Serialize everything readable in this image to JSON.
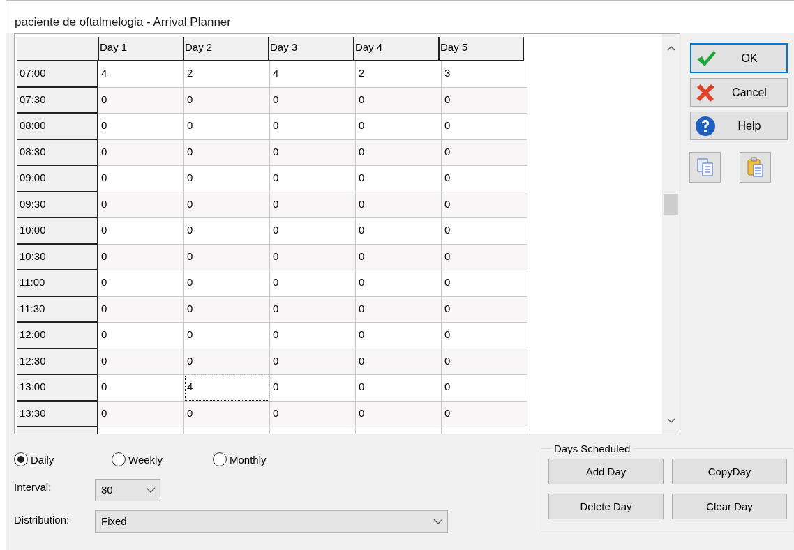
{
  "window": {
    "title": "paciente de oftalmelogia - Arrival Planner"
  },
  "grid": {
    "columns": [
      "Day 1",
      "Day 2",
      "Day 3",
      "Day 4",
      "Day 5"
    ],
    "rows": [
      {
        "time": "07:00",
        "cells": [
          {
            "value": "4",
            "focused": false
          },
          {
            "value": "2",
            "focused": false
          },
          {
            "value": "4",
            "focused": false
          },
          {
            "value": "2",
            "focused": false
          },
          {
            "value": "3",
            "focused": false
          }
        ]
      },
      {
        "time": "07:30",
        "cells": [
          {
            "value": "0",
            "focused": false
          },
          {
            "value": "0",
            "focused": false
          },
          {
            "value": "0",
            "focused": false
          },
          {
            "value": "0",
            "focused": false
          },
          {
            "value": "0",
            "focused": false
          }
        ]
      },
      {
        "time": "08:00",
        "cells": [
          {
            "value": "0",
            "focused": false
          },
          {
            "value": "0",
            "focused": false
          },
          {
            "value": "0",
            "focused": false
          },
          {
            "value": "0",
            "focused": false
          },
          {
            "value": "0",
            "focused": false
          }
        ]
      },
      {
        "time": "08:30",
        "cells": [
          {
            "value": "0",
            "focused": false
          },
          {
            "value": "0",
            "focused": false
          },
          {
            "value": "0",
            "focused": false
          },
          {
            "value": "0",
            "focused": false
          },
          {
            "value": "0",
            "focused": false
          }
        ]
      },
      {
        "time": "09:00",
        "cells": [
          {
            "value": "0",
            "focused": false
          },
          {
            "value": "0",
            "focused": false
          },
          {
            "value": "0",
            "focused": false
          },
          {
            "value": "0",
            "focused": false
          },
          {
            "value": "0",
            "focused": false
          }
        ]
      },
      {
        "time": "09:30",
        "cells": [
          {
            "value": "0",
            "focused": false
          },
          {
            "value": "0",
            "focused": false
          },
          {
            "value": "0",
            "focused": false
          },
          {
            "value": "0",
            "focused": false
          },
          {
            "value": "0",
            "focused": false
          }
        ]
      },
      {
        "time": "10:00",
        "cells": [
          {
            "value": "0",
            "focused": false
          },
          {
            "value": "0",
            "focused": false
          },
          {
            "value": "0",
            "focused": false
          },
          {
            "value": "0",
            "focused": false
          },
          {
            "value": "0",
            "focused": false
          }
        ]
      },
      {
        "time": "10:30",
        "cells": [
          {
            "value": "0",
            "focused": false
          },
          {
            "value": "0",
            "focused": false
          },
          {
            "value": "0",
            "focused": false
          },
          {
            "value": "0",
            "focused": false
          },
          {
            "value": "0",
            "focused": false
          }
        ]
      },
      {
        "time": "11:00",
        "cells": [
          {
            "value": "0",
            "focused": false
          },
          {
            "value": "0",
            "focused": false
          },
          {
            "value": "0",
            "focused": false
          },
          {
            "value": "0",
            "focused": false
          },
          {
            "value": "0",
            "focused": false
          }
        ]
      },
      {
        "time": "11:30",
        "cells": [
          {
            "value": "0",
            "focused": false
          },
          {
            "value": "0",
            "focused": false
          },
          {
            "value": "0",
            "focused": false
          },
          {
            "value": "0",
            "focused": false
          },
          {
            "value": "0",
            "focused": false
          }
        ]
      },
      {
        "time": "12:00",
        "cells": [
          {
            "value": "0",
            "focused": false
          },
          {
            "value": "0",
            "focused": false
          },
          {
            "value": "0",
            "focused": false
          },
          {
            "value": "0",
            "focused": false
          },
          {
            "value": "0",
            "focused": false
          }
        ]
      },
      {
        "time": "12:30",
        "cells": [
          {
            "value": "0",
            "focused": false
          },
          {
            "value": "0",
            "focused": false
          },
          {
            "value": "0",
            "focused": false
          },
          {
            "value": "0",
            "focused": false
          },
          {
            "value": "0",
            "focused": false
          }
        ]
      },
      {
        "time": "13:00",
        "cells": [
          {
            "value": "0",
            "focused": false
          },
          {
            "value": "4",
            "focused": true
          },
          {
            "value": "0",
            "focused": false
          },
          {
            "value": "0",
            "focused": false
          },
          {
            "value": "0",
            "focused": false
          }
        ]
      },
      {
        "time": "13:30",
        "cells": [
          {
            "value": "0",
            "focused": false
          },
          {
            "value": "0",
            "focused": false
          },
          {
            "value": "0",
            "focused": false
          },
          {
            "value": "0",
            "focused": false
          },
          {
            "value": "0",
            "focused": false
          }
        ]
      }
    ]
  },
  "side_buttons": [
    {
      "label": "OK",
      "kind": "ok",
      "default": true
    },
    {
      "label": "Cancel",
      "kind": "cancel",
      "default": false
    },
    {
      "label": "Help",
      "kind": "help",
      "default": false
    }
  ],
  "tool_buttons": [
    {
      "kind": "copy"
    },
    {
      "kind": "paste"
    }
  ],
  "frequency": [
    {
      "label": "Daily",
      "selected": true
    },
    {
      "label": "Weekly",
      "selected": false
    },
    {
      "label": "Monthly",
      "selected": false
    }
  ],
  "interval": {
    "label": "Interval:",
    "value": "30"
  },
  "distribution": {
    "label": "Distribution:",
    "value": "Fixed"
  },
  "days_scheduled": {
    "title": "Days Scheduled",
    "buttons": [
      "Add Day",
      "CopyDay",
      "Delete Day",
      "Clear Day"
    ]
  }
}
